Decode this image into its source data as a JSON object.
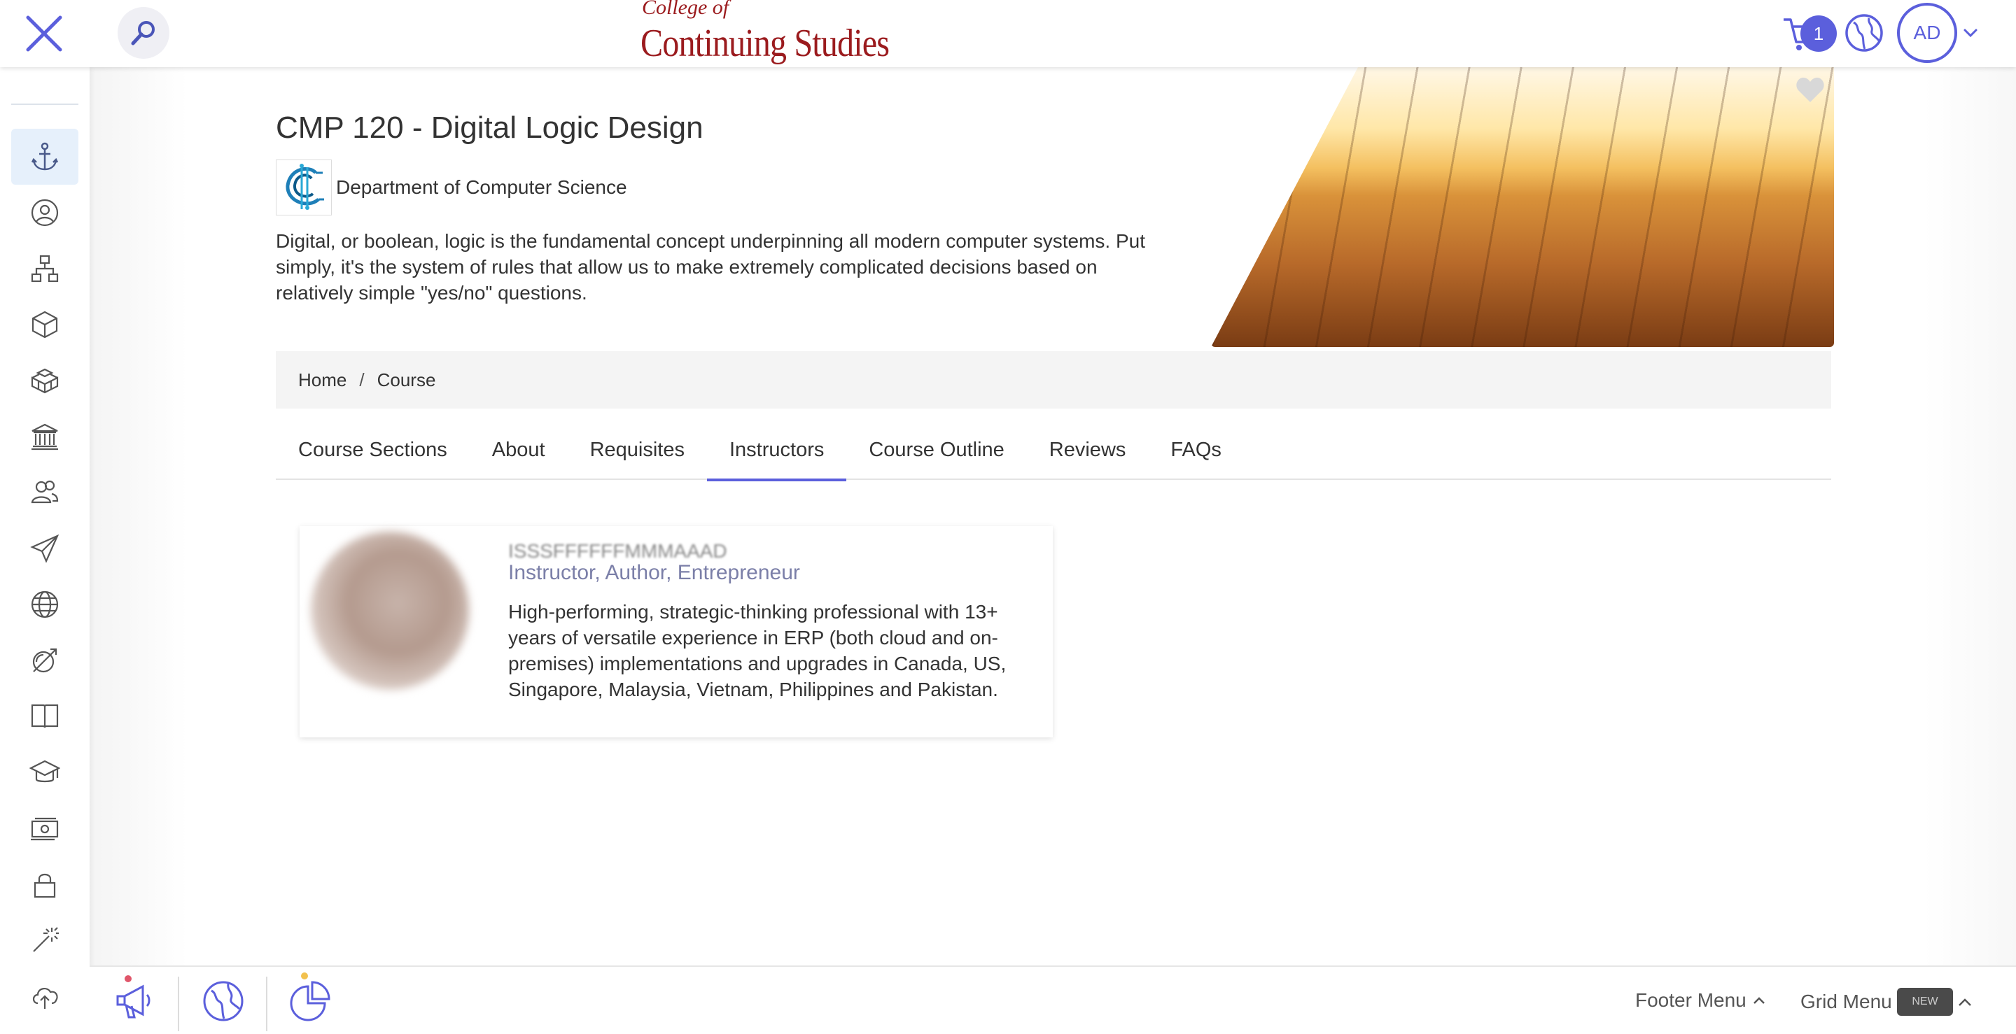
{
  "header": {
    "logo_small": "College of",
    "logo_big": "Continuing Studies",
    "cart_count": "1",
    "avatar_initials": "AD"
  },
  "sidebar": {
    "items": [
      {
        "icon": "anchor-icon",
        "active": true
      },
      {
        "icon": "user-circle-icon"
      },
      {
        "icon": "org-chart-icon"
      },
      {
        "icon": "cube-icon"
      },
      {
        "icon": "cubes-icon"
      },
      {
        "icon": "institution-icon"
      },
      {
        "icon": "users-icon"
      },
      {
        "icon": "paper-plane-icon"
      },
      {
        "icon": "globe-icon"
      },
      {
        "icon": "target-arrow-icon"
      },
      {
        "icon": "book-icon"
      },
      {
        "icon": "graduation-cap-icon"
      },
      {
        "icon": "money-icon"
      },
      {
        "icon": "lock-icon"
      },
      {
        "icon": "magic-wand-icon"
      },
      {
        "icon": "cloud-upload-icon"
      }
    ]
  },
  "course": {
    "title": "CMP 120 - Digital Logic Design",
    "department": "Department of Computer Science",
    "description": "Digital, or boolean, logic is the fundamental concept underpinning all modern computer systems. Put simply, it's the system of rules that allow us to make extremely complicated decisions based on relatively simple \"yes/no\" questions."
  },
  "breadcrumb": {
    "home": "Home",
    "separator": "/",
    "current": "Course"
  },
  "tabs": [
    {
      "label": "Course Sections"
    },
    {
      "label": "About"
    },
    {
      "label": "Requisites"
    },
    {
      "label": "Instructors",
      "active": true
    },
    {
      "label": "Course Outline"
    },
    {
      "label": "Reviews"
    },
    {
      "label": "FAQs"
    }
  ],
  "instructor": {
    "name": "ISSSFFFFFFMMMAAAD",
    "role": "Instructor, Author, Entrepreneur",
    "bio": "High-performing, strategic-thinking professional with 13+ years of versatile experience in ERP (both cloud and on-premises) implementations and upgrades in Canada, US, Singapore, Malaysia, Vietnam, Philippines and Pakistan."
  },
  "footer": {
    "footer_menu": "Footer Menu",
    "grid_menu": "Grid Menu",
    "new_badge": "NEW"
  },
  "colors": {
    "accent": "#5b5fdc",
    "logo": "#9b1b1e",
    "notification_dot_red": "#e0566a",
    "notification_dot_yellow": "#f2c14e"
  }
}
